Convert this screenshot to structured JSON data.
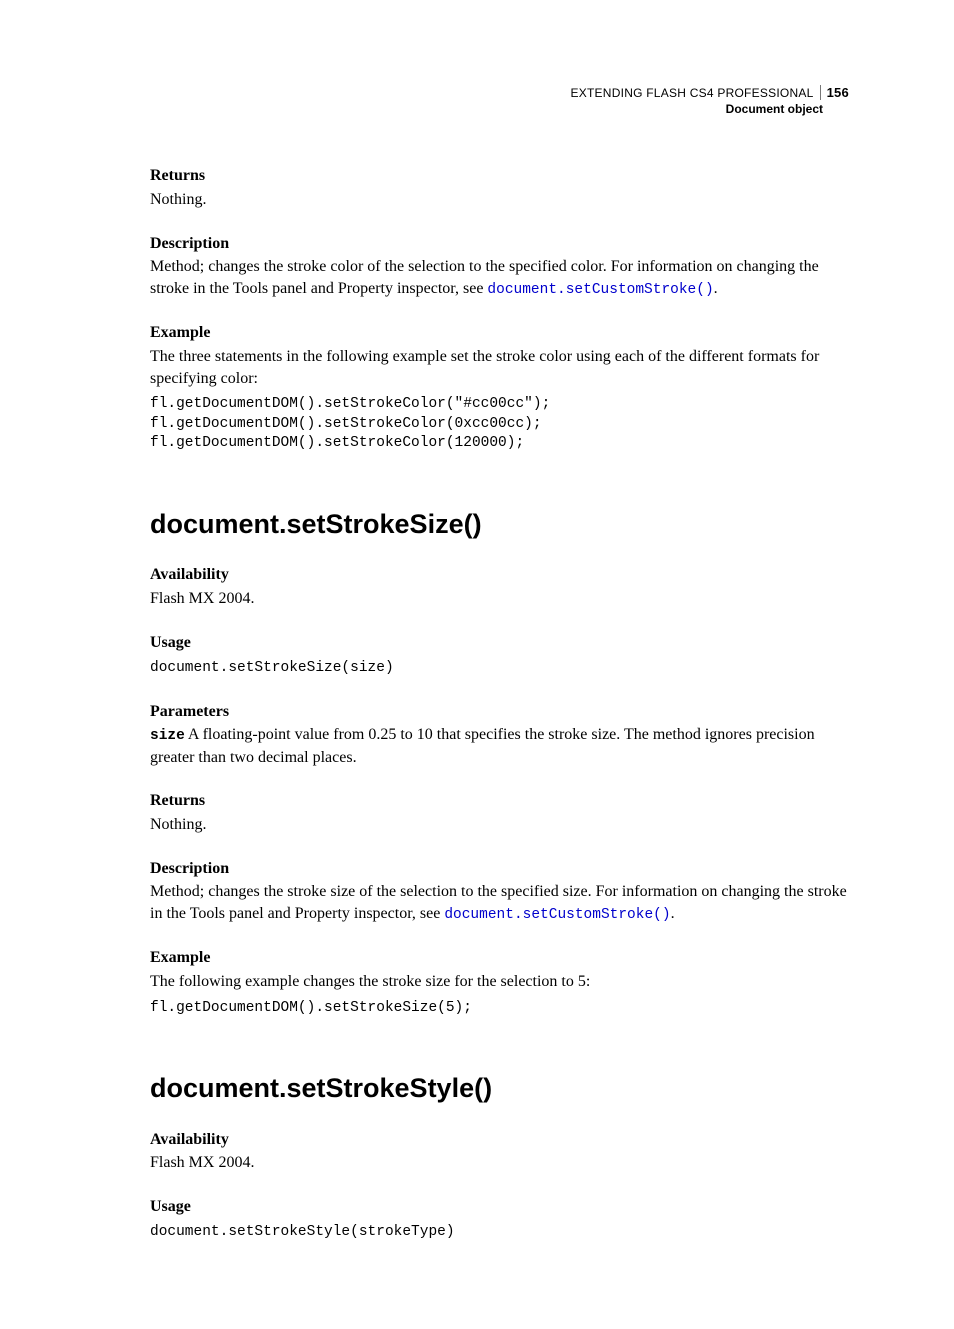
{
  "header": {
    "doc_title": "EXTENDING FLASH CS4 PROFESSIONAL",
    "page_number": "156",
    "section": "Document object"
  },
  "s1": {
    "returns_label": "Returns",
    "returns_text": "Nothing.",
    "desc_label": "Description",
    "desc_text_a": "Method; changes the stroke color of the selection to the specified color. For information on changing the stroke in the Tools panel and Property inspector, see ",
    "desc_link": "document.setCustomStroke()",
    "desc_text_b": ".",
    "example_label": "Example",
    "example_text": "The three statements in the following example set the stroke color using each of the different formats for specifying color:",
    "example_code": "fl.getDocumentDOM().setStrokeColor(\"#cc00cc\");\nfl.getDocumentDOM().setStrokeColor(0xcc00cc);\nfl.getDocumentDOM().setStrokeColor(120000);"
  },
  "s2": {
    "title": "document.setStrokeSize()",
    "avail_label": "Availability",
    "avail_text": "Flash MX 2004.",
    "usage_label": "Usage",
    "usage_code": "document.setStrokeSize(size)",
    "params_label": "Parameters",
    "param_name": "size",
    "param_text": " A floating-point value from 0.25 to 10 that specifies the stroke size. The method ignores precision greater than two decimal places.",
    "returns_label": "Returns",
    "returns_text": "Nothing.",
    "desc_label": "Description",
    "desc_text_a": "Method; changes the stroke size of the selection to the specified size. For information on changing the stroke in the Tools panel and Property inspector, see ",
    "desc_link": "document.setCustomStroke()",
    "desc_text_b": ".",
    "example_label": "Example",
    "example_text": "The following example changes the stroke size for the selection to 5:",
    "example_code": "fl.getDocumentDOM().setStrokeSize(5);"
  },
  "s3": {
    "title": "document.setStrokeStyle()",
    "avail_label": "Availability",
    "avail_text": "Flash MX 2004.",
    "usage_label": "Usage",
    "usage_code": "document.setStrokeStyle(strokeType)"
  }
}
